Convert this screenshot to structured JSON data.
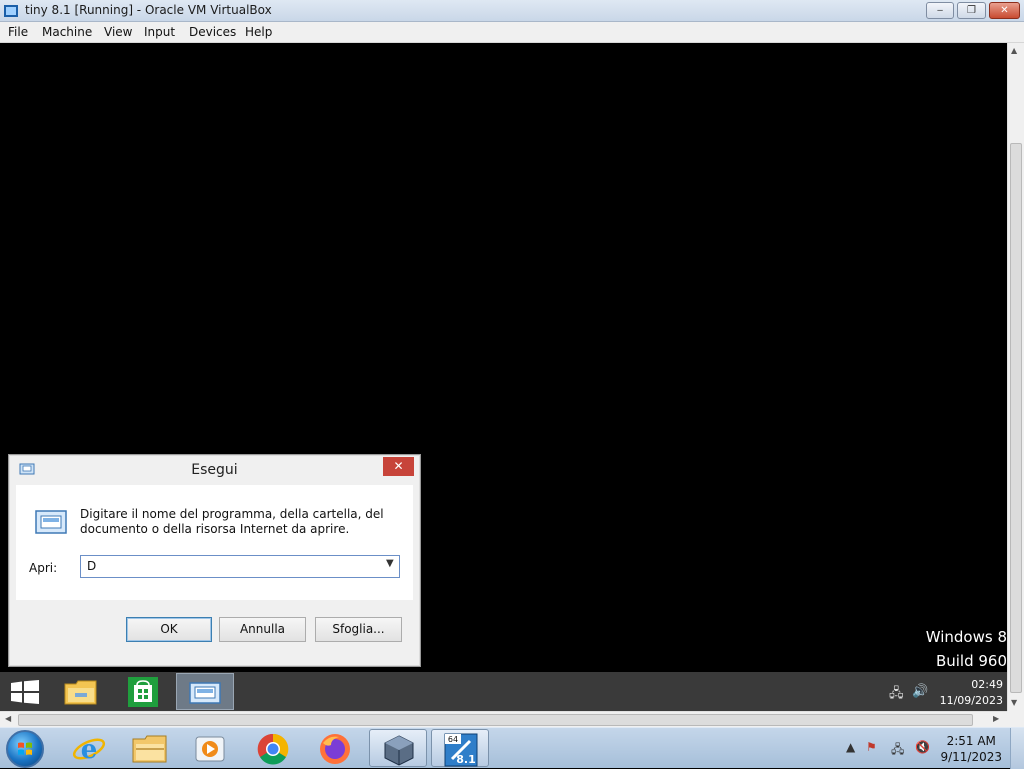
{
  "window": {
    "title": "tiny 8.1 [Running] - Oracle VM VirtualBox",
    "minimize": "‒",
    "maximize": "❐",
    "close": "✕"
  },
  "menu": [
    "File",
    "Machine",
    "View",
    "Input",
    "Devices",
    "Help"
  ],
  "run_dialog": {
    "title": "Esegui",
    "message": "Digitare il nome del programma, della cartella, del documento o della risorsa Internet da aprire.",
    "label": "Apri:",
    "input_value": "D",
    "ok": "OK",
    "cancel": "Annulla",
    "browse": "Sfoglia..."
  },
  "watermark": {
    "line1": "Windows 8",
    "line2": "Build 960"
  },
  "guest_taskbar": {
    "time": "02:49",
    "date": "11/09/2023",
    "pinned": [
      "start-icon",
      "file-explorer-icon",
      "store-icon",
      "run-icon"
    ]
  },
  "host_taskbar": {
    "time": "2:51 AM",
    "date": "9/11/2023",
    "pinned": [
      "internet-explorer-icon",
      "windows-explorer-icon",
      "media-player-icon",
      "chrome-icon",
      "firefox-icon",
      "virtualbox-icon",
      "windows-8-1-vm-icon"
    ],
    "vm_badge_top": "64",
    "vm_badge_label": "8.1"
  },
  "colors": {
    "run_close": "#c7443a",
    "guest_taskbar": "#3a3a3a",
    "host_taskbar": "#a6bfd9"
  }
}
